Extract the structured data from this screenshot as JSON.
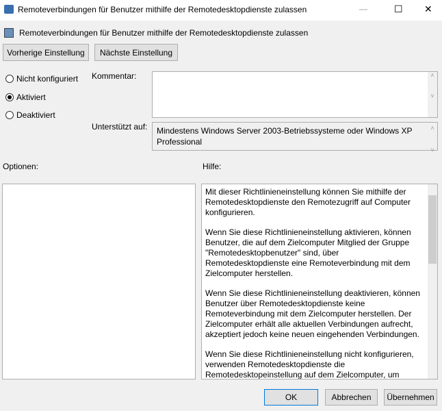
{
  "window": {
    "title": "Remoteverbindungen für Benutzer mithilfe der Remotedesktopdienste zulassen",
    "minimize": "—",
    "maximize": "☐",
    "close": "✕"
  },
  "header": {
    "title": "Remoteverbindungen für Benutzer mithilfe der Remotedesktopdienste zulassen"
  },
  "nav": {
    "previous": "Vorherige Einstellung",
    "next": "Nächste Einstellung"
  },
  "state": {
    "options": [
      {
        "label": "Nicht konfiguriert",
        "selected": false
      },
      {
        "label": "Aktiviert",
        "selected": true
      },
      {
        "label": "Deaktiviert",
        "selected": false
      }
    ]
  },
  "comment": {
    "label": "Kommentar:",
    "value": ""
  },
  "supported": {
    "label": "Unterstützt auf:",
    "value": "Mindestens Windows Server 2003-Betriebssysteme oder Windows XP Professional"
  },
  "options_label": "Optionen:",
  "help_label": "Hilfe:",
  "help": [
    "Mit dieser Richtlinieneinstellung können Sie mithilfe der Remotedesktopdienste den Remotezugriff auf Computer konfigurieren.",
    "Wenn Sie diese Richtlinieneinstellung aktivieren, können Benutzer, die auf dem Zielcomputer Mitglied der Gruppe \"Remotedesktopbenutzer\" sind, über Remotedesktopdienste eine Remoteverbindung mit dem Zielcomputer herstellen.",
    "Wenn Sie diese Richtlinieneinstellung deaktivieren, können Benutzer über Remotedesktopdienste keine Remoteverbindung mit dem Zielcomputer herstellen. Der Zielcomputer erhält alle aktuellen Verbindungen aufrecht, akzeptiert jedoch keine neuen eingehenden Verbindungen.",
    "Wenn Sie diese Richtlinieneinstellung nicht konfigurieren, verwenden Remotedesktopdienste die Remotedesktopeinstellung auf dem Zielcomputer, um festzustellen, ob die Remoteverbindung zulässig ist. Diese Einstellung befindet sich"
  ],
  "footer": {
    "ok": "OK",
    "cancel": "Abbrechen",
    "apply": "Übernehmen"
  }
}
